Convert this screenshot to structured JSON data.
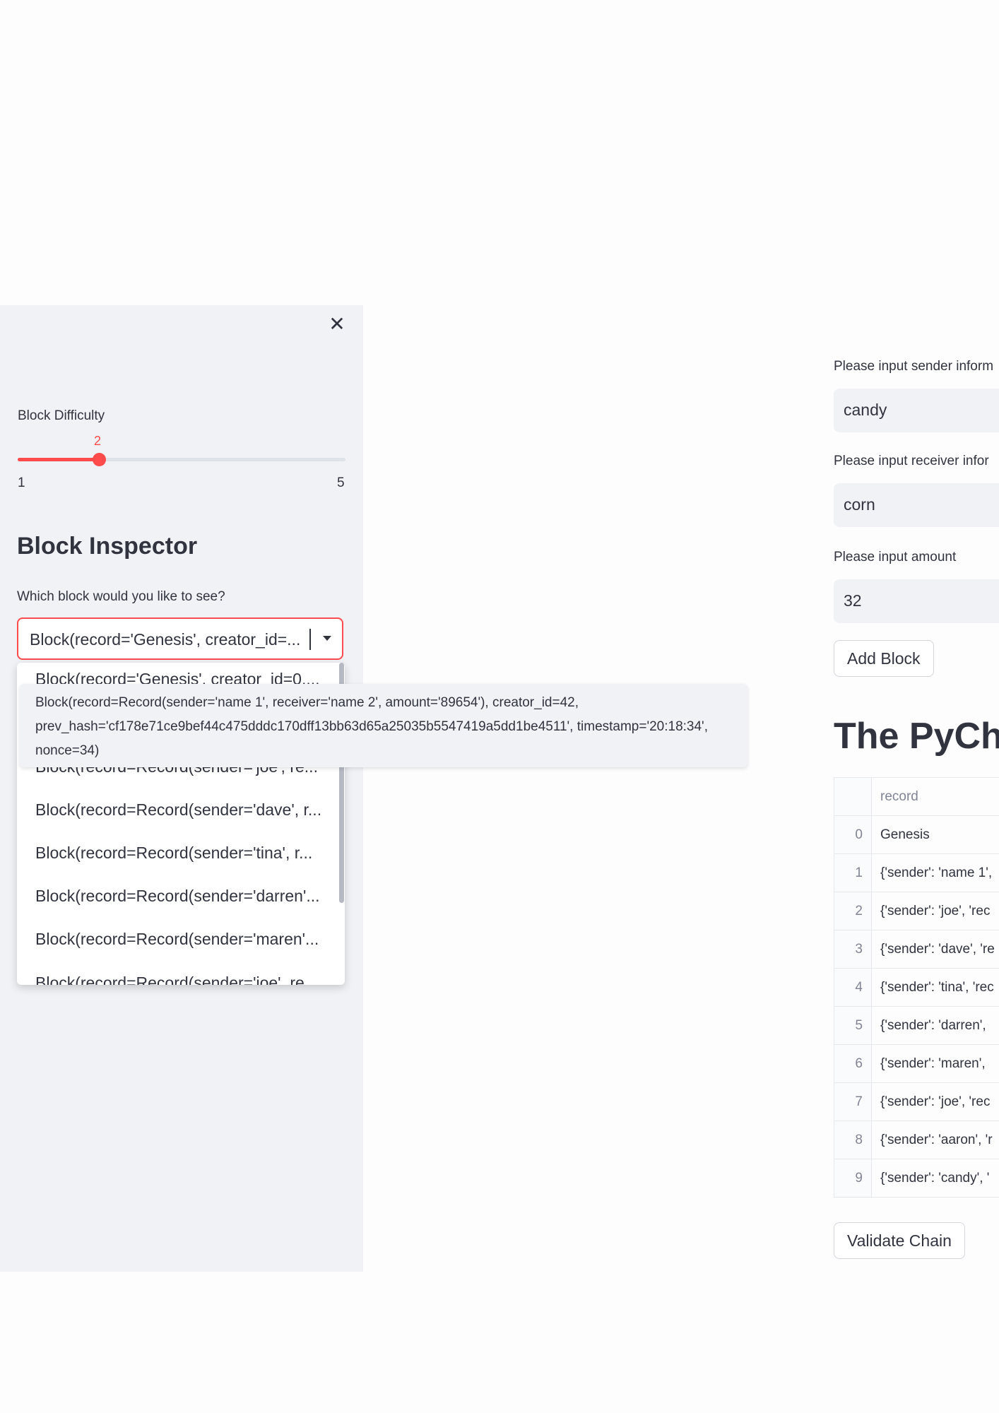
{
  "sidebar": {
    "slider": {
      "label": "Block Difficulty",
      "value": "2",
      "min": "1",
      "max": "5"
    },
    "inspector": {
      "heading": "Block Inspector",
      "prompt": "Which block would you like to see?",
      "selected": "Block(record='Genesis', creator_id=...",
      "options": [
        "Block(record='Genesis', creator_id=0,...",
        "Block(record=Record(sender='joe', re...",
        "Block(record=Record(sender='dave', r...",
        "Block(record=Record(sender='tina', r...",
        "Block(record=Record(sender='darren'...",
        "Block(record=Record(sender='maren'...",
        "Block(record=Record(sender='joe', re..."
      ],
      "tooltip": [
        "Block(record=Record(sender='name 1', receiver='name 2', amount='89654'), creator_id=42,",
        "prev_hash='cf178e71ce9bef44c475dddc170dff13bb63d65a25035b5547419a5dd1be4511', timestamp='20:18:34',",
        "nonce=34)"
      ]
    }
  },
  "main": {
    "sender_label": "Please input sender inform",
    "sender_value": "candy",
    "receiver_label": "Please input receiver infor",
    "receiver_value": "corn",
    "amount_label": "Please input amount",
    "amount_value": "32",
    "add_block": "Add Block",
    "title": "The PyCha",
    "table": {
      "header": "record",
      "rows": [
        {
          "index": "0",
          "record": "Genesis"
        },
        {
          "index": "1",
          "record": "{'sender': 'name 1',"
        },
        {
          "index": "2",
          "record": "{'sender': 'joe', 'rec"
        },
        {
          "index": "3",
          "record": "{'sender': 'dave', 're"
        },
        {
          "index": "4",
          "record": "{'sender': 'tina', 'rec"
        },
        {
          "index": "5",
          "record": "{'sender': 'darren',"
        },
        {
          "index": "6",
          "record": "{'sender': 'maren',"
        },
        {
          "index": "7",
          "record": "{'sender': 'joe', 'rec"
        },
        {
          "index": "8",
          "record": "{'sender': 'aaron', 'r"
        },
        {
          "index": "9",
          "record": "{'sender': 'candy', '"
        }
      ]
    },
    "validate": "Validate Chain"
  }
}
